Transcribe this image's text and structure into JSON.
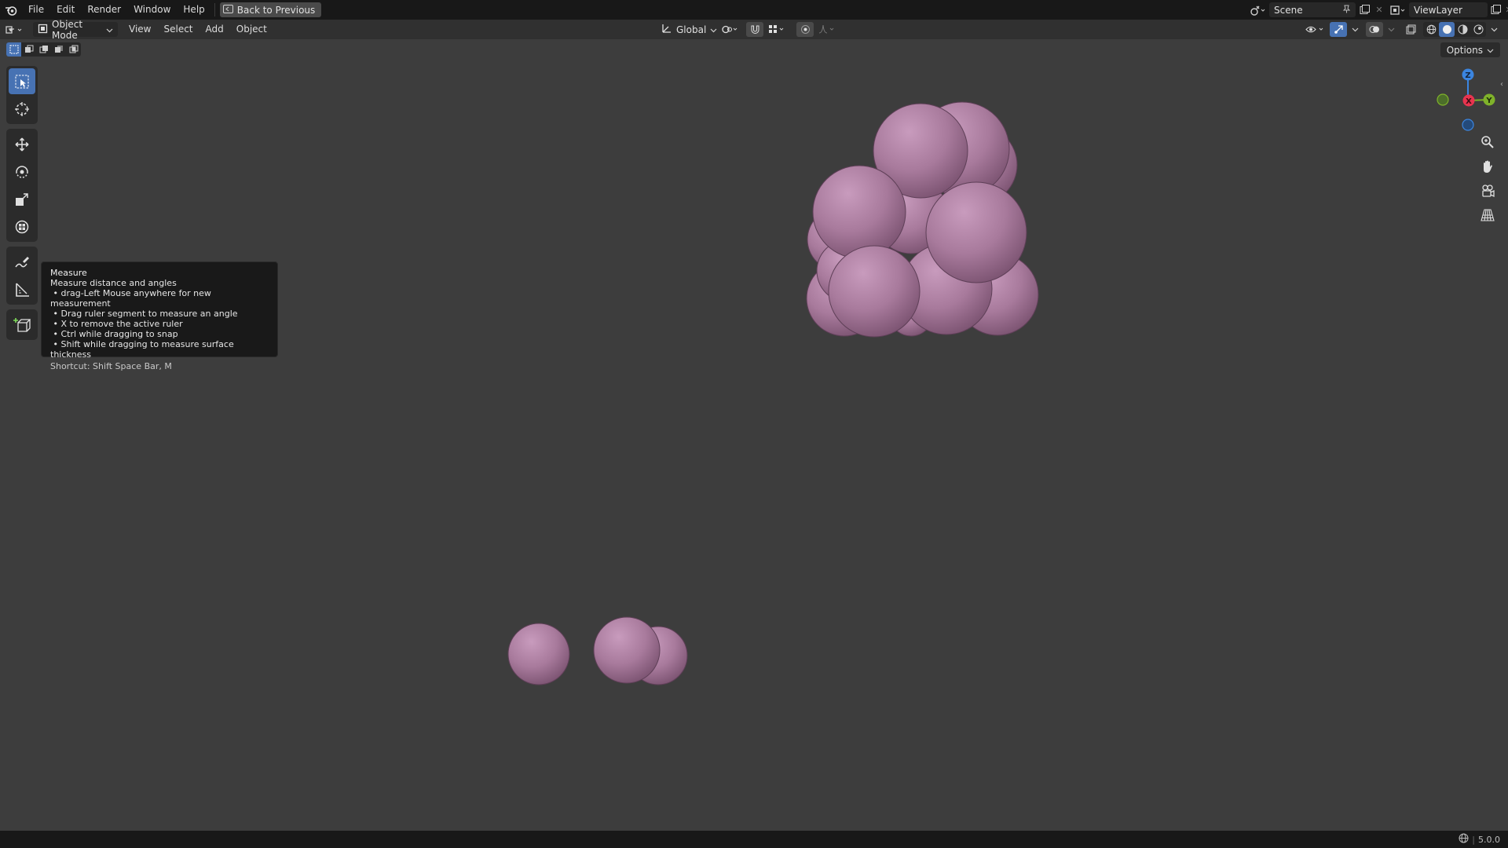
{
  "topbar": {
    "menus": [
      "File",
      "Edit",
      "Render",
      "Window",
      "Help"
    ],
    "back_button": "Back to Previous",
    "scene_name": "Scene",
    "view_layer": "ViewLayer"
  },
  "header": {
    "mode": "Object Mode",
    "menus": [
      "View",
      "Select",
      "Add",
      "Object"
    ],
    "transform_orientation": "Global",
    "options_label": "Options"
  },
  "tooltip": {
    "title": "Measure",
    "description": "Measure distance and angles",
    "bullets": [
      "drag-Left Mouse anywhere for new measurement",
      "Drag ruler segment to measure an angle",
      "X to remove the active ruler",
      "Ctrl while dragging to snap",
      "Shift while dragging to measure surface thickness"
    ],
    "shortcut": "Shortcut: Shift Space Bar, M"
  },
  "gizmo": {
    "z_label": "Z",
    "x_label": "X",
    "y_label": "Y",
    "colors": {
      "x": "#e8344f",
      "y": "#7fb22a",
      "z": "#3b85e0"
    }
  },
  "status": {
    "version": "5.0.0"
  },
  "colors": {
    "accent": "#4772b3",
    "sphere": "#a87a9c",
    "viewport": "#3d3d3d"
  }
}
